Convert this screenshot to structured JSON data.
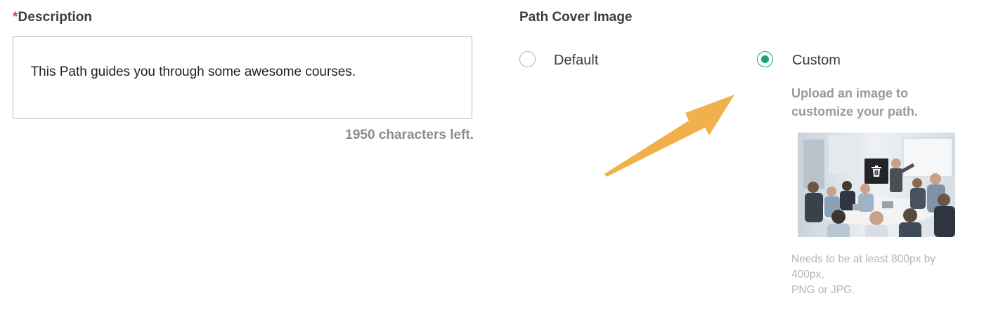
{
  "description": {
    "required_mark": "*",
    "label": "Description",
    "value": "This Path guides you through some awesome courses.",
    "chars_left": "1950 characters left."
  },
  "cover": {
    "label": "Path Cover Image",
    "options": [
      {
        "label": "Default",
        "selected": false
      },
      {
        "label": "Custom",
        "selected": true
      }
    ],
    "upload_hint": "Upload an image to customize your path.",
    "requirement_line1": "Needs to be at least 800px by 400px,",
    "requirement_line2": "PNG or JPG.",
    "delete_icon": "trash-icon"
  },
  "colors": {
    "accent": "#1aa37a",
    "arrow": "#f2b04b",
    "required": "#d64545"
  }
}
